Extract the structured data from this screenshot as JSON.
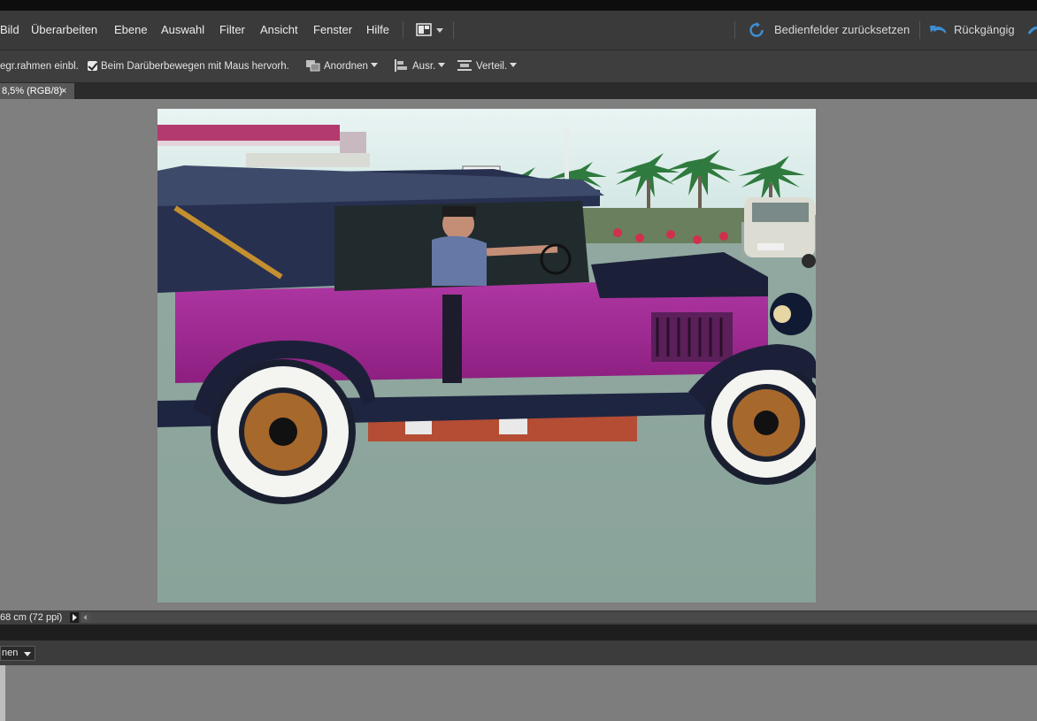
{
  "menubar": {
    "items": [
      "Bild",
      "Überarbeiten",
      "Ebene",
      "Auswahl",
      "Filter",
      "Ansicht",
      "Fenster",
      "Hilfe"
    ],
    "reset_panels_label": "Bedienfelder zurücksetzen",
    "undo_label": "Rückgängig",
    "accent_color": "#3d8fd4"
  },
  "options": {
    "bounding_box_label": "egr.rahmen einbl.",
    "highlight_checkbox_label": "Beim Darüberbewegen mit Maus hervorh.",
    "arrange_label": "Anordnen",
    "align_label": "Ausr.",
    "distribute_label": "Verteil."
  },
  "document": {
    "tab_label": "8,5% (RGB/8)",
    "close_glyph": "×"
  },
  "status": {
    "doc_size": "68 cm (72 ppi)"
  },
  "bin": {
    "select_value": "nen"
  }
}
